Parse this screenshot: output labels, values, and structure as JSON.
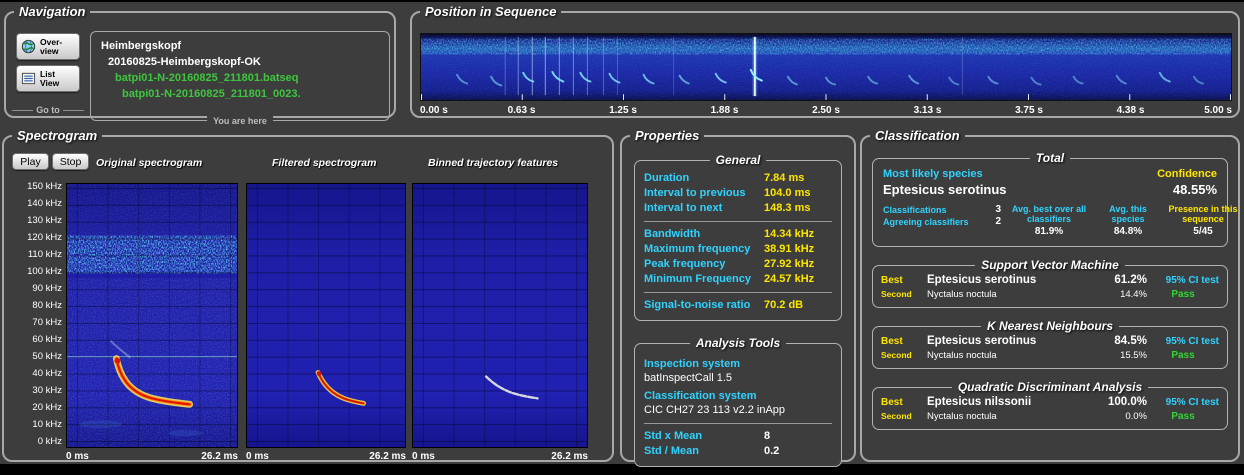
{
  "navigation": {
    "title": "Navigation",
    "overview_button": {
      "line1": "Over-",
      "line2": "view"
    },
    "listview_button": {
      "line1": "List",
      "line2": "View"
    },
    "go_to_label": "Go to",
    "you_are_here_label": "You are here",
    "path": {
      "site": "Heimbergskopf",
      "session": "20160825-Heimbergskopf-OK",
      "sequence": "batpi01-N-20160825_211801.batseq",
      "call": "batpi01-N-20160825_211801_0023."
    }
  },
  "position_in_sequence": {
    "title": "Position in Sequence",
    "time_labels": [
      "0.00 s",
      "0.63 s",
      "1.25 s",
      "1.88 s",
      "2.50 s",
      "3.13 s",
      "3.75 s",
      "4.38 s",
      "5.00 s"
    ]
  },
  "spectrogram": {
    "title": "Spectrogram",
    "play_button": "Play",
    "stop_button": "Stop",
    "views": [
      "Original spectrogram",
      "Filtered spectrogram",
      "Binned trajectory features"
    ],
    "freq_labels": [
      "150 kHz",
      "140 kHz",
      "130 kHz",
      "120 kHz",
      "110 kHz",
      "100 kHz",
      "90 kHz",
      "80 kHz",
      "70 kHz",
      "60 kHz",
      "50 kHz",
      "40 kHz",
      "30 kHz",
      "20 kHz",
      "10 kHz",
      "0 kHz"
    ],
    "time_axis": {
      "start": "0 ms",
      "end": "26.2 ms"
    }
  },
  "properties": {
    "title": "Properties",
    "general": {
      "title": "General",
      "timing_rows": [
        {
          "label": "Duration",
          "value": "7.84 ms"
        },
        {
          "label": "Interval to previous",
          "value": "104.0 ms"
        },
        {
          "label": "Interval to next",
          "value": "148.3 ms"
        }
      ],
      "frequency_rows": [
        {
          "label": "Bandwidth",
          "value": "14.34 kHz"
        },
        {
          "label": "Maximum frequency",
          "value": "38.91 kHz"
        },
        {
          "label": "Peak frequency",
          "value": "27.92 kHz"
        },
        {
          "label": "Minimum Frequency",
          "value": "24.57 kHz"
        }
      ],
      "snr_row": {
        "label": "Signal-to-noise ratio",
        "value": "70.2 dB"
      }
    },
    "analysis_tools": {
      "title": "Analysis Tools",
      "inspection_label": "Inspection system",
      "inspection_value": "batInspectCall 1.5",
      "classification_label": "Classification system",
      "classification_value": "CIC CH27 23 113 v2.2 inApp",
      "std_rows": [
        {
          "label": "Std x Mean",
          "value": "8"
        },
        {
          "label": "Std / Mean",
          "value": "0.2"
        }
      ]
    }
  },
  "classification": {
    "title": "Classification",
    "total": {
      "title": "Total",
      "most_likely_label": "Most likely species",
      "confidence_label": "Confidence",
      "species": "Eptesicus serotinus",
      "confidence": "48.55%",
      "classifications_label": "Classifications",
      "classifications_value": "3",
      "agreeing_label": "Agreeing classifiers",
      "agreeing_value": "2",
      "avg_best_label": "Avg. best over all classifiers",
      "avg_best_value": "81.9%",
      "avg_species_label": "Avg. this species",
      "avg_species_value": "84.8%",
      "presence_label": "Presence in this sequence",
      "presence_value": "5/45"
    },
    "classifiers": [
      {
        "title": "Support Vector Machine",
        "best_label": "Best",
        "best_species": "Eptesicus serotinus",
        "best_pct": "61.2%",
        "ci_label": "95% CI test",
        "second_label": "Second",
        "second_species": "Nyctalus noctula",
        "second_pct": "14.4%",
        "ci_result": "Pass"
      },
      {
        "title": "K Nearest Neighbours",
        "best_label": "Best",
        "best_species": "Eptesicus serotinus",
        "best_pct": "84.5%",
        "ci_label": "95% CI test",
        "second_label": "Second",
        "second_species": "Nyctalus noctula",
        "second_pct": "15.5%",
        "ci_result": "Pass"
      },
      {
        "title": "Quadratic Discriminant Analysis",
        "best_label": "Best",
        "best_species": "Eptesicus nilssonii",
        "best_pct": "100.0%",
        "ci_label": "95% CI test",
        "second_label": "Second",
        "second_species": "Nyctalus noctula",
        "second_pct": "0.0%",
        "ci_result": "Pass"
      }
    ]
  },
  "colors": {
    "label_cyan": "#2fd3ff",
    "value_yellow": "#ffe600",
    "pass_green": "#33d633",
    "sequence_green": "#3ec73e",
    "panel_bg": "#3d3d3d",
    "spectrogram_blue": "#1d1daa"
  }
}
